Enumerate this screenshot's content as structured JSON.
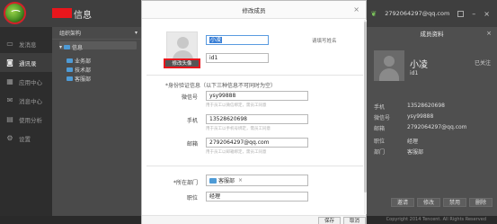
{
  "app": {
    "title": "信息"
  },
  "topbar": {
    "email": "2792064297@qq.com"
  },
  "sidebar": {
    "items": [
      {
        "label": "发消息",
        "icon": "chat-icon"
      },
      {
        "label": "通讯录",
        "icon": "contacts-icon"
      },
      {
        "label": "应用中心",
        "icon": "apps-icon"
      },
      {
        "label": "消息中心",
        "icon": "message-icon"
      },
      {
        "label": "使用分析",
        "icon": "analytics-icon"
      },
      {
        "label": "设置",
        "icon": "gear-icon"
      }
    ]
  },
  "org": {
    "header": "组织架构",
    "root": "信息",
    "departments": [
      "业务部",
      "技术部",
      "客服部"
    ]
  },
  "modal": {
    "title": "修改成员",
    "name_value": "小凌",
    "name_hint": "请填写姓名",
    "userid_value": "id1",
    "avatar_button": "修改头像",
    "section_title": "*身份验证信息（以下三种信息不可同时为空）",
    "wechat_label": "微信号",
    "wechat_value": "ysy99888",
    "wechat_sub": "用于员工以微信绑定，需员工同意",
    "phone_label": "手机",
    "phone_value": "13528620698",
    "phone_sub": "用于员工以手机号绑定，需员工同意",
    "email_label": "邮箱",
    "email_value": "2792064297@qq.com",
    "email_sub": "用于员工以邮箱绑定，需员工同意",
    "dept_label": "*所在部门",
    "dept_value": "客服部",
    "position_label": "职位",
    "position_value": "经理",
    "save_button": "保存",
    "cancel_button": "取消"
  },
  "userpanel": {
    "title": "成员资料",
    "name": "小凌",
    "userid": "id1",
    "status": "已关注",
    "rows": [
      {
        "label": "手机",
        "value": "13528620698"
      },
      {
        "label": "微信号",
        "value": "ysy99888"
      },
      {
        "label": "邮箱",
        "value": "2792064297@qq.com"
      },
      {
        "label": "职位",
        "value": "经理"
      },
      {
        "label": "部门",
        "value": "客服部"
      }
    ],
    "buttons": [
      "邀请",
      "修改",
      "禁用",
      "删除"
    ]
  },
  "statusbar": {
    "text": "Copyright 2014 Tencent. All Rights Reserved"
  },
  "colors": {
    "accent": "#3a7fd5",
    "highlight": "#e8161c",
    "dark_bg": "#3b3b3b"
  }
}
